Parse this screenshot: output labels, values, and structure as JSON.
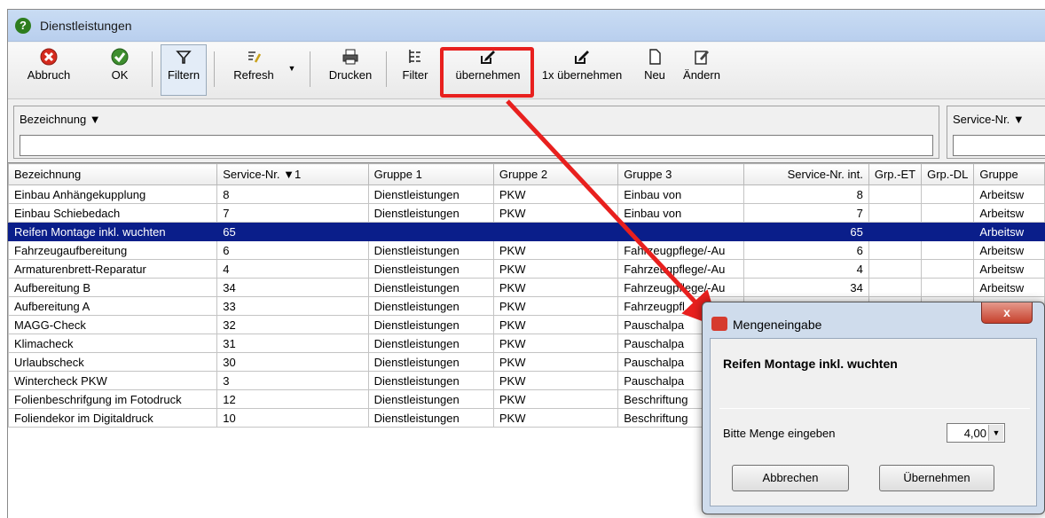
{
  "window": {
    "title": "Dienstleistungen",
    "app_icon_glyph": "?"
  },
  "toolbar": {
    "cancel": "Abbruch",
    "ok": "OK",
    "filter_toggle": "Filtern",
    "refresh": "Refresh",
    "print": "Drucken",
    "filter": "Filter",
    "apply": "übernehmen",
    "apply_once": "1x übernehmen",
    "new": "Neu",
    "edit": "Ändern"
  },
  "filters": {
    "description_label": "Bezeichnung ▼",
    "service_no_label": "Service-Nr. ▼",
    "description_value": "",
    "service_no_value": ""
  },
  "table": {
    "columns": [
      "Bezeichnung",
      "Service-Nr. ▼1",
      "Gruppe 1",
      "Gruppe 2",
      "Gruppe 3",
      "Service-Nr. int.",
      "Grp.-ET",
      "Grp.-DL",
      "Gruppe"
    ],
    "rows": [
      [
        "Einbau Anhängekupplung",
        "8",
        "Dienstleistungen",
        "PKW",
        "Einbau von",
        "8",
        "",
        "",
        "Arbeitsw"
      ],
      [
        "Einbau Schiebedach",
        "7",
        "Dienstleistungen",
        "PKW",
        "Einbau von",
        "7",
        "",
        "",
        "Arbeitsw"
      ],
      [
        "Reifen Montage inkl. wuchten",
        "65",
        "",
        "",
        "",
        "65",
        "",
        "",
        "Arbeitsw"
      ],
      [
        "Fahrzeugaufbereitung",
        "6",
        "Dienstleistungen",
        "PKW",
        "Fahrzeugpflege/-Au",
        "6",
        "",
        "",
        "Arbeitsw"
      ],
      [
        "Armaturenbrett-Reparatur",
        "4",
        "Dienstleistungen",
        "PKW",
        "Fahrzeugpflege/-Au",
        "4",
        "",
        "",
        "Arbeitsw"
      ],
      [
        "Aufbereitung B",
        "34",
        "Dienstleistungen",
        "PKW",
        "Fahrzeugpflege/-Au",
        "34",
        "",
        "",
        "Arbeitsw"
      ],
      [
        "Aufbereitung A",
        "33",
        "Dienstleistungen",
        "PKW",
        "Fahrzeugpfl",
        "",
        "",
        "",
        ""
      ],
      [
        "MAGG-Check",
        "32",
        "Dienstleistungen",
        "PKW",
        "Pauschalpa",
        "",
        "",
        "",
        ""
      ],
      [
        "Klimacheck",
        "31",
        "Dienstleistungen",
        "PKW",
        "Pauschalpa",
        "",
        "",
        "",
        ""
      ],
      [
        "Urlaubscheck",
        "30",
        "Dienstleistungen",
        "PKW",
        "Pauschalpa",
        "",
        "",
        "",
        ""
      ],
      [
        "Wintercheck PKW",
        "3",
        "Dienstleistungen",
        "PKW",
        "Pauschalpa",
        "",
        "",
        "",
        ""
      ],
      [
        "Folienbeschrifgung im Fotodruck",
        "12",
        "Dienstleistungen",
        "PKW",
        "Beschriftung",
        "",
        "",
        "",
        ""
      ],
      [
        "Foliendekor im Digitaldruck",
        "10",
        "Dienstleistungen",
        "PKW",
        "Beschriftung",
        "",
        "",
        "",
        ""
      ]
    ],
    "selected_row": 2
  },
  "dialog": {
    "title": "Mengeneingabe",
    "close": "x",
    "item_name": "Reifen Montage inkl. wuchten",
    "quantity_label": "Bitte Menge eingeben",
    "quantity_value": "4,00",
    "cancel": "Abbrechen",
    "confirm": "Übernehmen"
  },
  "colors": {
    "selection": "#0a1e8a",
    "annotation": "#e8201e"
  }
}
